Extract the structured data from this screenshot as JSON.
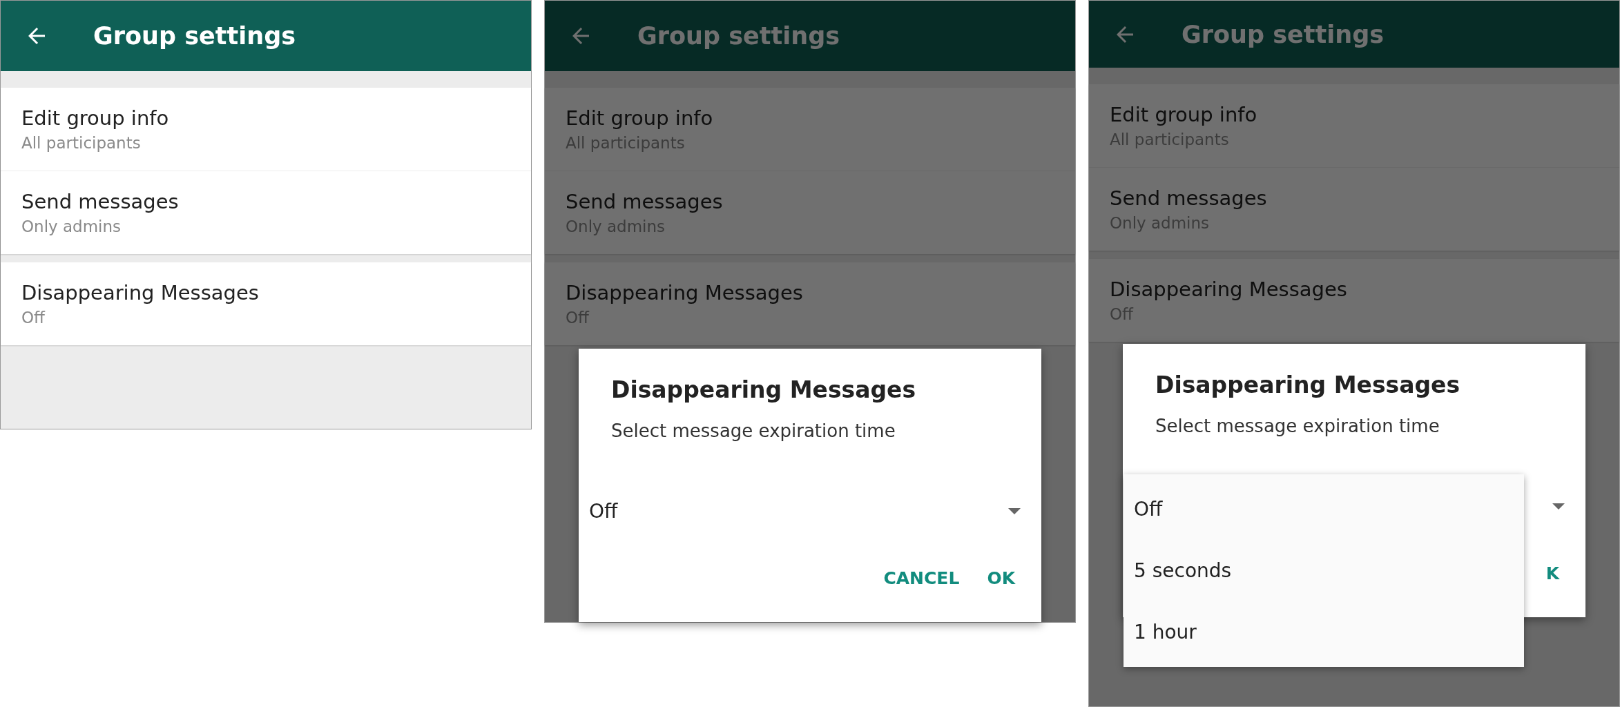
{
  "screens": [
    {
      "header": {
        "title": "Group settings"
      },
      "dimmed": false,
      "sections": [
        {
          "items": [
            {
              "title": "Edit group info",
              "subtitle": "All participants"
            },
            {
              "title": "Send messages",
              "subtitle": "Only admins"
            }
          ]
        },
        {
          "items": [
            {
              "title": "Disappearing Messages",
              "subtitle": "Off"
            }
          ]
        }
      ]
    },
    {
      "header": {
        "title": "Group settings"
      },
      "dimmed": true,
      "sections": [
        {
          "items": [
            {
              "title": "Edit group info",
              "subtitle": "All participants"
            },
            {
              "title": "Send messages",
              "subtitle": "Only admins"
            }
          ]
        },
        {
          "items": [
            {
              "title": "Disappearing Messages",
              "subtitle": "Off"
            }
          ]
        }
      ],
      "dialog": {
        "title": "Disappearing Messages",
        "subtitle": "Select message expiration time",
        "dropdown": {
          "value": "Off"
        },
        "buttons": [
          "CANCEL",
          "OK"
        ]
      }
    },
    {
      "header": {
        "title": "Group settings"
      },
      "dimmed": true,
      "sections": [
        {
          "items": [
            {
              "title": "Edit group info",
              "subtitle": "All participants"
            },
            {
              "title": "Send messages",
              "subtitle": "Only admins"
            }
          ]
        },
        {
          "items": [
            {
              "title": "Disappearing Messages",
              "subtitle": "Off"
            }
          ]
        }
      ],
      "dialog": {
        "title": "Disappearing Messages",
        "subtitle": "Select message expiration time",
        "buttons": [
          "K"
        ],
        "menu": {
          "options": [
            "Off",
            "5 seconds",
            "1 hour"
          ]
        }
      }
    }
  ]
}
